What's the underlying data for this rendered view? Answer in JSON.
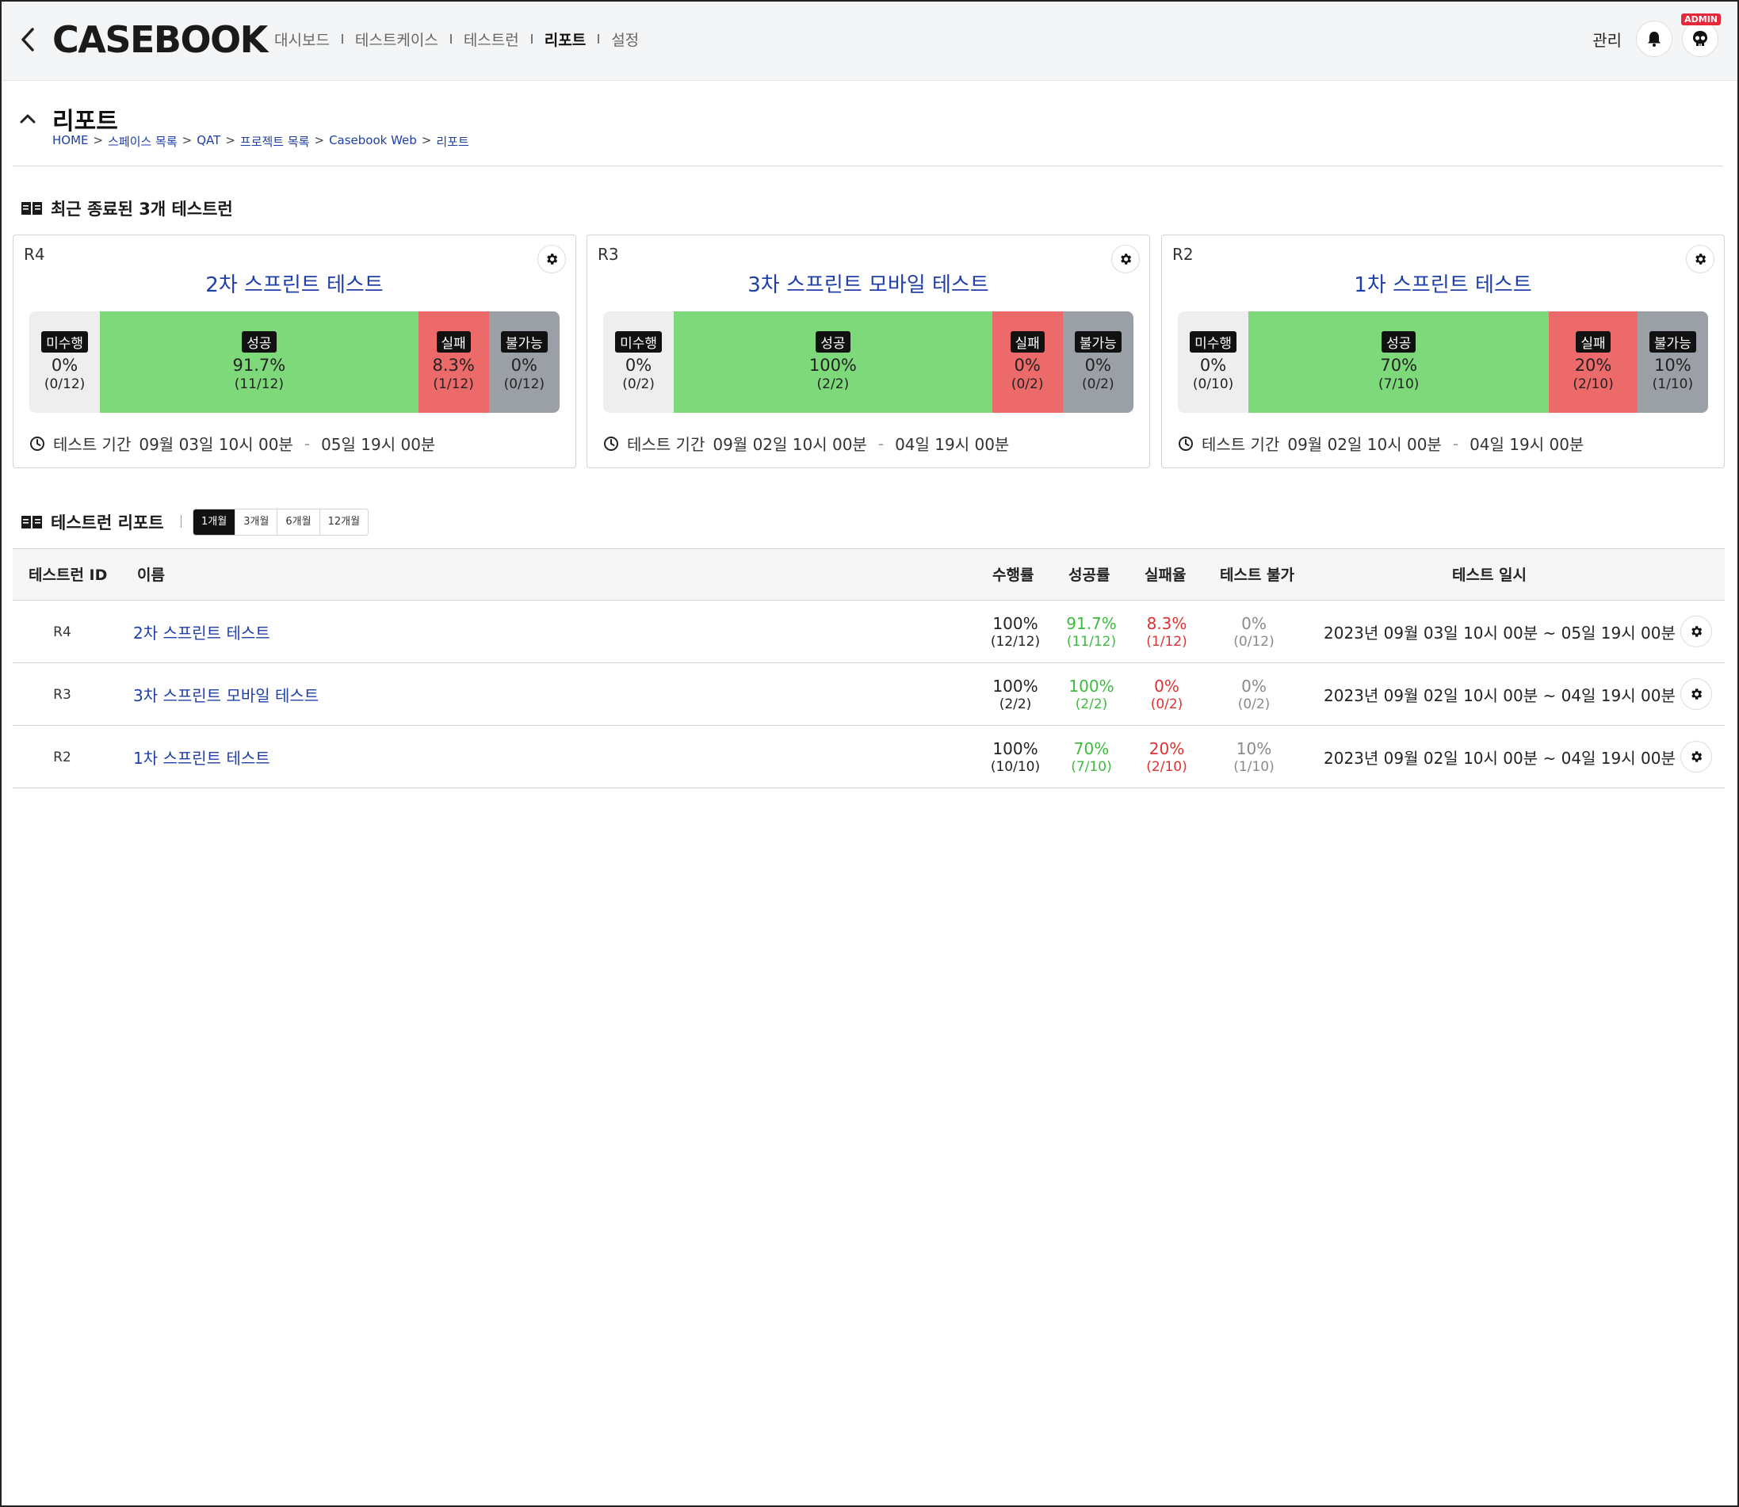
{
  "header": {
    "logo": "CASEBOOK",
    "nav": [
      "대시보드",
      "테스트케이스",
      "테스트런",
      "리포트",
      "설정"
    ],
    "manage": "관리",
    "admin_badge": "ADMIN"
  },
  "page": {
    "title": "리포트",
    "breadcrumb": [
      "HOME",
      "스페이스 목록",
      "QAT",
      "프로젝트 목록",
      "Casebook Web",
      "리포트"
    ],
    "breadcrumb_sep": ">"
  },
  "recent": {
    "heading": "최근 종료된 3개 테스트런",
    "status_labels": {
      "untested": "미수행",
      "passed": "성공",
      "failed": "실패",
      "untestable": "불가능"
    },
    "period_label": "테스트 기간",
    "period_dash": "-",
    "cards": [
      {
        "id": "R4",
        "title": "2차 스프린트 테스트",
        "untested": {
          "pct": "0%",
          "cnt": "(0/12)",
          "ratio": 0.1333
        },
        "passed": {
          "pct": "91.7%",
          "cnt": "(11/12)",
          "ratio": 0.6
        },
        "failed": {
          "pct": "8.3%",
          "cnt": "(1/12)",
          "ratio": 0.1333
        },
        "untestable": {
          "pct": "0%",
          "cnt": "(0/12)",
          "ratio": 0.1333
        },
        "start": "09월 03일 10시 00분",
        "end": "05일 19시 00분"
      },
      {
        "id": "R3",
        "title": "3차 스프린트 모바일 테스트",
        "untested": {
          "pct": "0%",
          "cnt": "(0/2)",
          "ratio": 0.1333
        },
        "passed": {
          "pct": "100%",
          "cnt": "(2/2)",
          "ratio": 0.6
        },
        "failed": {
          "pct": "0%",
          "cnt": "(0/2)",
          "ratio": 0.1333
        },
        "untestable": {
          "pct": "0%",
          "cnt": "(0/2)",
          "ratio": 0.1333
        },
        "start": "09월 02일 10시 00분",
        "end": "04일 19시 00분"
      },
      {
        "id": "R2",
        "title": "1차 스프린트 테스트",
        "untested": {
          "pct": "0%",
          "cnt": "(0/10)",
          "ratio": 0.1333
        },
        "passed": {
          "pct": "70%",
          "cnt": "(7/10)",
          "ratio": 0.5667
        },
        "failed": {
          "pct": "20%",
          "cnt": "(2/10)",
          "ratio": 0.1667
        },
        "untestable": {
          "pct": "10%",
          "cnt": "(1/10)",
          "ratio": 0.1333
        },
        "start": "09월 02일 10시 00분",
        "end": "04일 19시 00분"
      }
    ]
  },
  "report": {
    "heading": "테스트런 리포트",
    "tabs": [
      "1개월",
      "3개월",
      "6개월",
      "12개월"
    ],
    "active_tab": "1개월",
    "columns": {
      "id": "테스트런 ID",
      "name": "이름",
      "exec": "수행률",
      "pass": "성공률",
      "fail": "실패율",
      "untestable": "테스트 불가",
      "date": "테스트 일시"
    },
    "rows": [
      {
        "id": "R4",
        "name": "2차 스프린트 테스트",
        "exec": "100%",
        "exec_cnt": "(12/12)",
        "pass": "91.7%",
        "pass_cnt": "(11/12)",
        "fail": "8.3%",
        "fail_cnt": "(1/12)",
        "untestable": "0%",
        "untestable_cnt": "(0/12)",
        "date": "2023년 09월 03일 10시 00분 ~ 05일 19시 00분"
      },
      {
        "id": "R3",
        "name": "3차 스프린트 모바일 테스트",
        "exec": "100%",
        "exec_cnt": "(2/2)",
        "pass": "100%",
        "pass_cnt": "(2/2)",
        "fail": "0%",
        "fail_cnt": "(0/2)",
        "untestable": "0%",
        "untestable_cnt": "(0/2)",
        "date": "2023년 09월 02일 10시 00분 ~ 04일 19시 00분"
      },
      {
        "id": "R2",
        "name": "1차 스프린트 테스트",
        "exec": "100%",
        "exec_cnt": "(10/10)",
        "pass": "70%",
        "pass_cnt": "(7/10)",
        "fail": "20%",
        "fail_cnt": "(2/10)",
        "untestable": "10%",
        "untestable_cnt": "(1/10)",
        "date": "2023년 09월 02일 10시 00분 ~ 04일 19시 00분"
      }
    ]
  },
  "colors": {
    "link": "#1f3fa8",
    "passed": "#7ed97a",
    "failed": "#ec6a6a",
    "untested": "#eeeeee",
    "untestable": "#9ba0a6",
    "admin_badge": "#e5293a"
  },
  "icons": [
    "back-arrow-icon",
    "bell-icon",
    "skull-icon",
    "chevron-up-icon",
    "book-icon",
    "gear-icon",
    "clock-icon"
  ]
}
